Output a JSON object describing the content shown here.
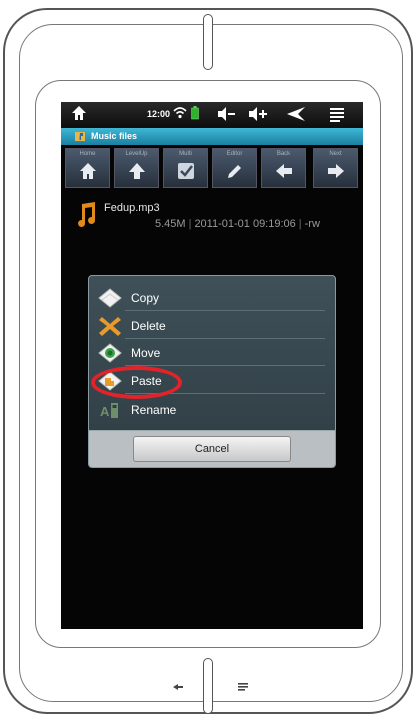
{
  "statusbar": {
    "time": "12:00"
  },
  "titlebar": {
    "label": "Music files"
  },
  "toolbar": {
    "buttons": [
      {
        "label": "Home"
      },
      {
        "label": "LevelUp"
      },
      {
        "label": "Multi"
      },
      {
        "label": "Editor"
      },
      {
        "label": "Back"
      },
      {
        "label": "Next"
      }
    ]
  },
  "file": {
    "name": "Fedup.mp3",
    "size": "5.45M",
    "datetime": "2011-01-01 09:19:06",
    "attr": "-rw"
  },
  "dialog": {
    "items": [
      {
        "label": "Copy"
      },
      {
        "label": "Delete"
      },
      {
        "label": "Move"
      },
      {
        "label": "Paste"
      },
      {
        "label": "Rename"
      }
    ],
    "cancel_label": "Cancel"
  },
  "colors": {
    "highlight": "#e2232a",
    "titlebar": "#2a9cc0",
    "dialog": "#3a4a52",
    "file_icon": "#e08a1c"
  }
}
